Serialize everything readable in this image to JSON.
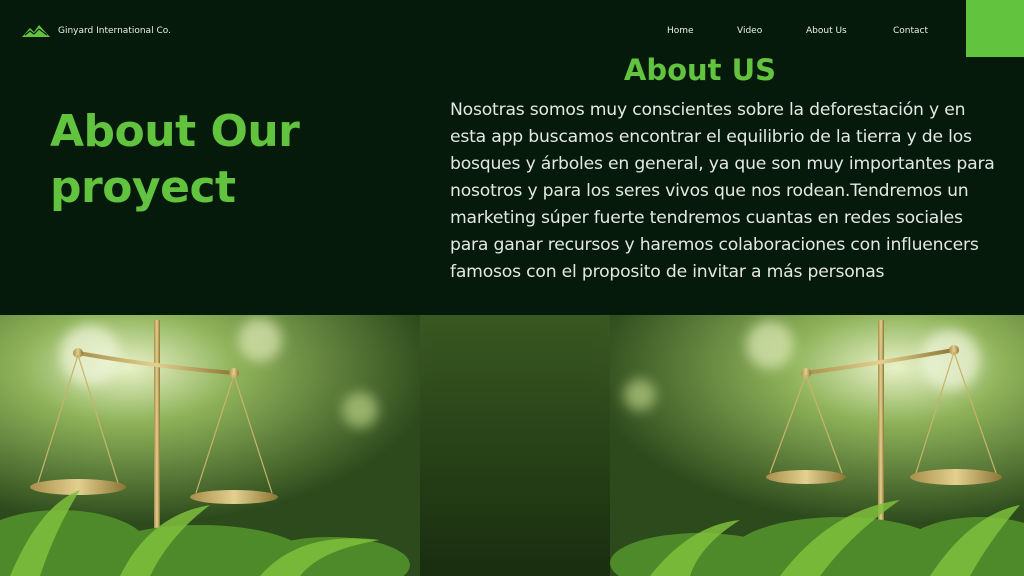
{
  "brand": {
    "name": "Ginyard International Co.",
    "logo_icon": "mountain-logo-icon"
  },
  "nav": {
    "items": [
      {
        "label": "Home"
      },
      {
        "label": "Video"
      },
      {
        "label": "About Us"
      },
      {
        "label": "Contact"
      }
    ]
  },
  "hero": {
    "title": "About Our proyect"
  },
  "about": {
    "heading": "About US",
    "body": "Nosotras somos muy conscientes sobre la deforestación y en esta app buscamos encontrar el equilibrio de la tierra y de los bosques y árboles en general,  ya que son muy importantes para nosotros y para los seres vivos que nos rodean.Tendremos un marketing súper fuerte tendremos cuantas en redes sociales para ganar recursos y haremos colaboraciones con influencers famosos con el proposito de invitar a más personas"
  },
  "colors": {
    "background": "#061a0c",
    "accent": "#62c43e",
    "text": "#e3e8e2"
  }
}
